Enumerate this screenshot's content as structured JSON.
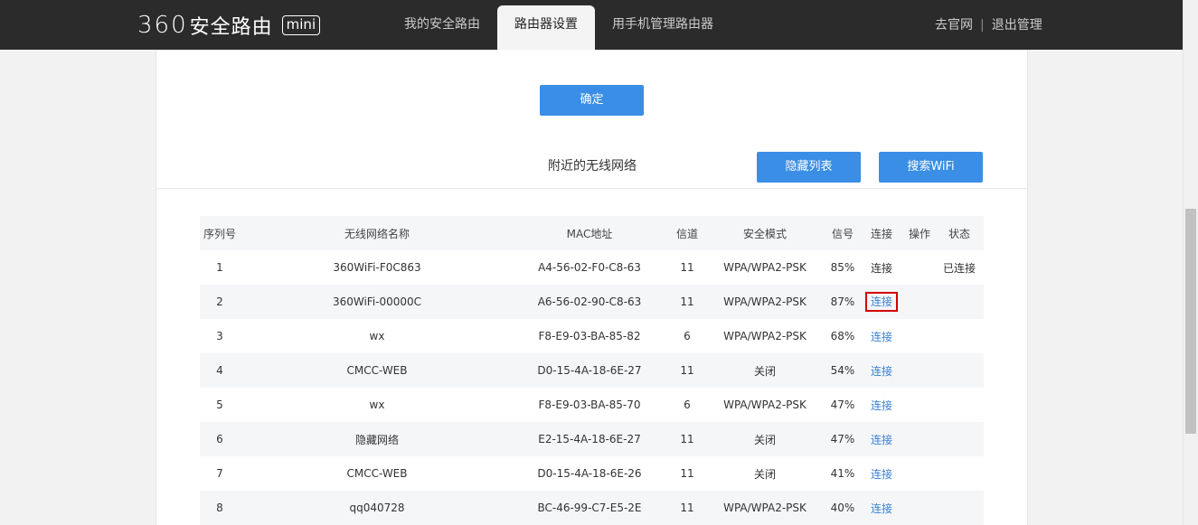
{
  "header": {
    "logo_num": "360",
    "logo_text": "安全路由",
    "logo_badge": "mini",
    "tabs": [
      {
        "label": "我的安全路由",
        "active": false
      },
      {
        "label": "路由器设置",
        "active": true
      },
      {
        "label": "用手机管理路由器",
        "active": false
      }
    ],
    "link_official": "去官网",
    "separator": "|",
    "link_logout": "退出管理"
  },
  "panel": {
    "confirm_label": "确定",
    "section_title": "附近的无线网络",
    "hide_list_label": "隐藏列表",
    "search_wifi_label": "搜索WiFi"
  },
  "table": {
    "headers": {
      "idx": "序列号",
      "name": "无线网络名称",
      "mac": "MAC地址",
      "channel": "信道",
      "security": "安全模式",
      "signal": "信号",
      "connect": "连接",
      "op": "操作",
      "status": "状态"
    },
    "rows": [
      {
        "idx": "1",
        "name": "360WiFi-F0C863",
        "mac": "A4-56-02-F0-C8-63",
        "channel": "11",
        "security": "WPA/WPA2-PSK",
        "signal": "85%",
        "connect": "连接",
        "connect_link": false,
        "status": "已连接"
      },
      {
        "idx": "2",
        "name": "360WiFi-00000C",
        "mac": "A6-56-02-90-C8-63",
        "channel": "11",
        "security": "WPA/WPA2-PSK",
        "signal": "87%",
        "connect": "连接",
        "connect_link": true,
        "status": ""
      },
      {
        "idx": "3",
        "name": "wx",
        "mac": "F8-E9-03-BA-85-82",
        "channel": "6",
        "security": "WPA/WPA2-PSK",
        "signal": "68%",
        "connect": "连接",
        "connect_link": true,
        "status": ""
      },
      {
        "idx": "4",
        "name": "CMCC-WEB",
        "mac": "D0-15-4A-18-6E-27",
        "channel": "11",
        "security": "关闭",
        "signal": "54%",
        "connect": "连接",
        "connect_link": true,
        "status": ""
      },
      {
        "idx": "5",
        "name": "wx",
        "mac": "F8-E9-03-BA-85-70",
        "channel": "6",
        "security": "WPA/WPA2-PSK",
        "signal": "47%",
        "connect": "连接",
        "connect_link": true,
        "status": ""
      },
      {
        "idx": "6",
        "name": "隐藏网络",
        "mac": "E2-15-4A-18-6E-27",
        "channel": "11",
        "security": "关闭",
        "signal": "47%",
        "connect": "连接",
        "connect_link": true,
        "status": ""
      },
      {
        "idx": "7",
        "name": "CMCC-WEB",
        "mac": "D0-15-4A-18-6E-26",
        "channel": "11",
        "security": "关闭",
        "signal": "41%",
        "connect": "连接",
        "connect_link": true,
        "status": ""
      },
      {
        "idx": "8",
        "name": "qq040728",
        "mac": "BC-46-99-C7-E5-2E",
        "channel": "11",
        "security": "WPA/WPA2-PSK",
        "signal": "40%",
        "connect": "连接",
        "connect_link": true,
        "status": ""
      }
    ]
  },
  "colors": {
    "topbar": "#2b2b2b",
    "accent": "#3a8ee6",
    "link": "#3a7fd5",
    "highlight": "#d40000"
  }
}
